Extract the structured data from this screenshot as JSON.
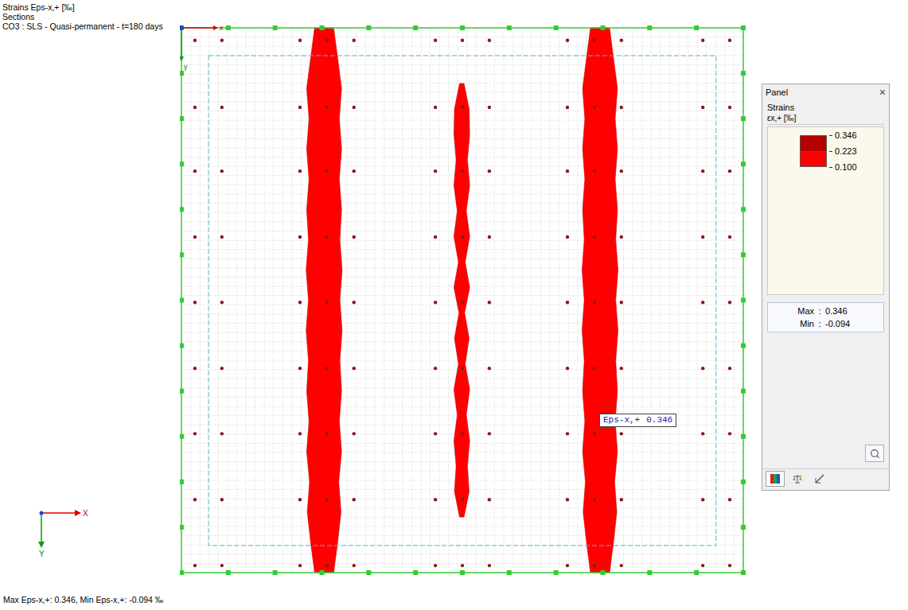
{
  "header": {
    "lines": [
      "Strains Eps-x,+ [‰]",
      "Sections",
      "CO3 : SLS - Quasi-permanent - t=180 days"
    ]
  },
  "origin_axes": {
    "x": "x",
    "y": "y"
  },
  "view_axes": {
    "x": "X",
    "y": "Y"
  },
  "strips": [
    {
      "center": 0.254,
      "from": 0,
      "to": 1,
      "half_widths": [
        0.017,
        0.024,
        0.031,
        0.027,
        0.031,
        0.027,
        0.031,
        0.028,
        0.032,
        0.028,
        0.032,
        0.028,
        0.031,
        0.027,
        0.031,
        0.026,
        0.03,
        0.024,
        0.017
      ]
    },
    {
      "center": 0.499,
      "from": 0.102,
      "to": 0.898,
      "half_widths": [
        0.004,
        0.013,
        0.014,
        0.01,
        0.014,
        0.008,
        0.014,
        0.006,
        0.014,
        0.005,
        0.013,
        0.006,
        0.014,
        0.008,
        0.014,
        0.01,
        0.013,
        0.004
      ]
    },
    {
      "center": 0.745,
      "from": 0,
      "to": 1,
      "half_widths": [
        0.017,
        0.024,
        0.031,
        0.027,
        0.031,
        0.027,
        0.031,
        0.028,
        0.032,
        0.028,
        0.032,
        0.028,
        0.031,
        0.027,
        0.031,
        0.026,
        0.03,
        0.024,
        0.017
      ]
    }
  ],
  "supports": {
    "x": [
      0.024,
      0.072,
      0.211,
      0.259,
      0.307,
      0.452,
      0.5,
      0.548,
      0.687,
      0.735,
      0.783,
      0.928,
      0.976
    ],
    "y": [
      0.023,
      0.146,
      0.263,
      0.384,
      0.504,
      0.625,
      0.745,
      0.866,
      0.987
    ]
  },
  "tooltip": {
    "label": "Eps-x,+",
    "value": "0.346"
  },
  "panel": {
    "title": "Panel",
    "close": "×",
    "group": "Strains",
    "quantity": "εx,+ [‰]",
    "scale": {
      "values": [
        "0.346",
        "0.223",
        "0.100"
      ],
      "bands": [
        {
          "color": "#b40000"
        },
        {
          "color": "#ff0000"
        }
      ]
    },
    "separator": ":",
    "max": {
      "label": "Max",
      "value": "0.346"
    },
    "min": {
      "label": "Min",
      "value": "-0.094"
    },
    "tabs": [
      {
        "selected": true
      },
      {
        "selected": false
      },
      {
        "selected": false
      }
    ]
  },
  "status": "Max Eps-x,+: 0.346, Min Eps-x,+: -0.094 ‰"
}
